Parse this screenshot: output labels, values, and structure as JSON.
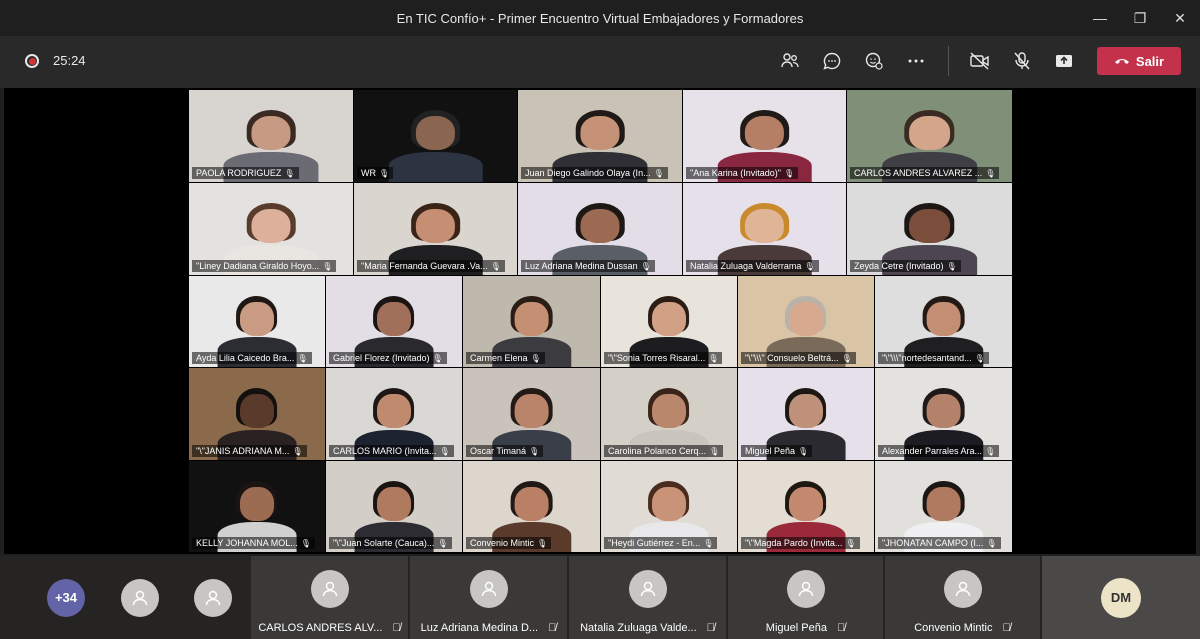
{
  "window": {
    "title": "En TIC Confío+ - Primer Encuentro Virtual Embajadores y Formadores",
    "minimize_glyph": "—",
    "maximize_glyph": "❐",
    "close_glyph": "✕"
  },
  "toolbar": {
    "timer": "25:24",
    "leave_label": "Salir",
    "icons": [
      "people-icon",
      "chat-icon",
      "reactions-icon",
      "more-icon",
      "camera-off-icon",
      "mic-off-icon",
      "share-icon"
    ]
  },
  "colors": {
    "leave_button": "#c4314b",
    "more_badge": "#6264a7",
    "record_dot": "#d13438"
  },
  "tiles": [
    {
      "name": "PAOLA RODRIGUEZ",
      "bg": "#d8d4cf",
      "skin": "#c79b83",
      "hair": "#3a2a22",
      "shirt": "#6b6b73"
    },
    {
      "name": "WR",
      "bg": "#111111",
      "skin": "#8a6550",
      "hair": "#222222",
      "shirt": "#2b3440"
    },
    {
      "name": "Juan Diego Galindo Olaya (In...",
      "bg": "#c9c3b7",
      "skin": "#c69277",
      "hair": "#1f1a18",
      "shirt": "#2f2f35"
    },
    {
      "name": "\"Ana Karina (Invitado)\"",
      "bg": "#e7e2ea",
      "skin": "#b57f66",
      "hair": "#201a18",
      "shirt": "#8a2740"
    },
    {
      "name": "CARLOS ANDRES ALVAREZ ...",
      "bg": "#7f8f78",
      "skin": "#d3a58a",
      "hair": "#3a2b22",
      "shirt": "#3e3e44"
    },
    {
      "name": "\"Liney Dadiana Giraldo Hoyo...",
      "bg": "#e4e2e0",
      "skin": "#dcb09b",
      "hair": "#5a3c2c",
      "shirt": "#e9e6e2"
    },
    {
      "name": "\"Maria Fernanda Guevara .Va...",
      "bg": "#dad5ce",
      "skin": "#c68f73",
      "hair": "#3a2418",
      "shirt": "#1f1f22"
    },
    {
      "name": "Luz Adriana Medina Dussan",
      "bg": "#e3dde8",
      "skin": "#9c6a52",
      "hair": "#1d1715",
      "shirt": "#5a5e66"
    },
    {
      "name": "Natalia Zuluaga Valderrama",
      "bg": "#e6e0ea",
      "skin": "#e0b496",
      "hair": "#c98a2e",
      "shirt": "#4a3a3a"
    },
    {
      "name": "Zeyda Cetre (Invitado)",
      "bg": "#dcdcdc",
      "skin": "#7a4e3a",
      "hair": "#1c1614",
      "shirt": "#4d4550"
    },
    {
      "name": "Ayda Lilia Caicedo Bra...",
      "bg": "#e9e9e9",
      "skin": "#c89b82",
      "hair": "#1f1814",
      "shirt": "#2b2d33"
    },
    {
      "name": "Gabriel Florez (Invitado)",
      "bg": "#e3dde6",
      "skin": "#a0705a",
      "hair": "#1a1513",
      "shirt": "#2a2a2e"
    },
    {
      "name": "Carmen Elena",
      "bg": "#bfb8ad",
      "skin": "#c58f73",
      "hair": "#2a1d16",
      "shirt": "#3b3b40"
    },
    {
      "name": "\"\\\"Sonia Torres  Risaral...",
      "bg": "#e8e4dc",
      "skin": "#d2a084",
      "hair": "#2b1d15",
      "shirt": "#1d1d20"
    },
    {
      "name": "\"\\\"\\\\\\\" Consuelo Beltrá...",
      "bg": "#d9c5a6",
      "skin": "#d7aa90",
      "hair": "#b9b2a8",
      "shirt": "#7a6a5a"
    },
    {
      "name": "\"\\\"\\\\\\\"nortedesantand...",
      "bg": "#dedede",
      "skin": "#c48e72",
      "hair": "#241a15",
      "shirt": "#1f1f22"
    },
    {
      "name": "\"\\\"JANIS ADRIANA M...",
      "bg": "#8a6a4a",
      "skin": "#5a3a2a",
      "hair": "#141010",
      "shirt": "#2a2222"
    },
    {
      "name": "CARLOS MARIO (Invita...",
      "bg": "#dad8d4",
      "skin": "#c08a6e",
      "hair": "#1d1815",
      "shirt": "#1d2230"
    },
    {
      "name": "Oscar Timaná",
      "bg": "#c9c3bb",
      "skin": "#b98469",
      "hair": "#231a15",
      "shirt": "#3a3e48"
    },
    {
      "name": "Carolina Polanco Cerq...",
      "bg": "#d4cfc7",
      "skin": "#b9886c",
      "hair": "#3a241a",
      "shirt": "#c9c4bd"
    },
    {
      "name": "Miguel Peña",
      "bg": "#e6e0ea",
      "skin": "#c0917a",
      "hair": "#1d1714",
      "shirt": "#2a2a30"
    },
    {
      "name": "Alexander Parrales Ara...",
      "bg": "#e4e2df",
      "skin": "#b4826a",
      "hair": "#1f1a18",
      "shirt": "#1c1c22"
    },
    {
      "name": "KELLY JOHANNA MOL...",
      "bg": "#111111",
      "skin": "#9b6b52",
      "hair": "#1a1412",
      "shirt": "#d0d0d0"
    },
    {
      "name": "\"\\\"Juan Solarte (Cauca)...",
      "bg": "#d3cfc8",
      "skin": "#b07a5e",
      "hair": "#1a1513",
      "shirt": "#2c2c32"
    },
    {
      "name": "Convenio Mintic",
      "bg": "#dcd6cc",
      "skin": "#b98066",
      "hair": "#201915",
      "shirt": "#5a3a2a"
    },
    {
      "name": "\"Heydi Gutiérrez - En...",
      "bg": "#e0dbd4",
      "skin": "#c99378",
      "hair": "#4a2c1e",
      "shirt": "#e8e8ea"
    },
    {
      "name": "\"\\\"Magda Pardo (Invita...",
      "bg": "#e3ddd4",
      "skin": "#c48a70",
      "hair": "#1e1712",
      "shirt": "#9a2a3a"
    },
    {
      "name": "\"JHONATAN CAMPO (I...",
      "bg": "#e2e0dc",
      "skin": "#b07a60",
      "hair": "#1c1614",
      "shirt": "#f0f0f2"
    }
  ],
  "bottom": {
    "more_count": "+34",
    "named": [
      "CARLOS ANDRES ALV...",
      "Luz Adriana Medina D...",
      "Natalia Zuluaga Valde...",
      "Miguel Peña",
      "Convenio Mintic"
    ],
    "self_initials": "DM"
  }
}
